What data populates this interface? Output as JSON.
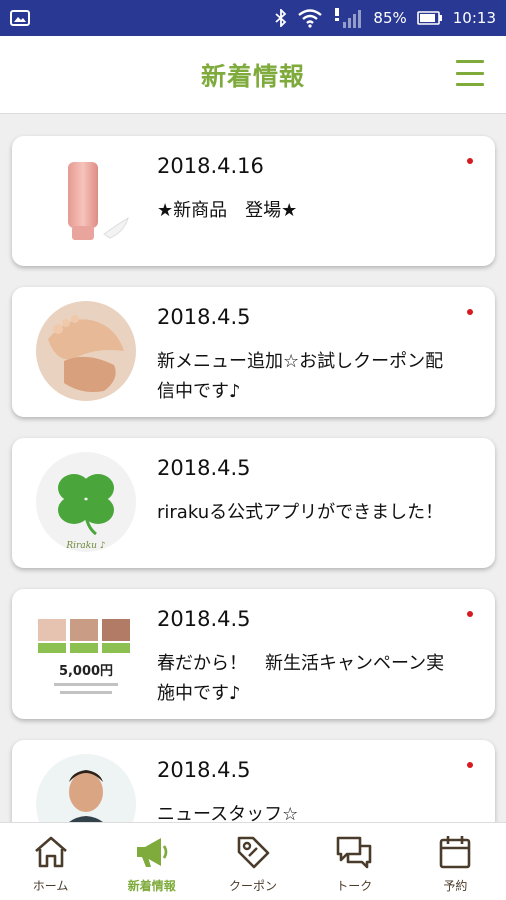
{
  "status_bar": {
    "battery": "85%",
    "time": "10:13"
  },
  "header": {
    "title": "新着情報"
  },
  "news": [
    {
      "date": "2018.4.16",
      "title": "★新商品　登場★",
      "unread": true
    },
    {
      "date": "2018.4.5",
      "title": "新メニュー追加☆お試しクーポン配信中です♪",
      "unread": true
    },
    {
      "date": "2018.4.5",
      "title": "rirakuる公式アプリができました！",
      "unread": false
    },
    {
      "date": "2018.4.5",
      "title": "春だから！　新生活キャンペーン実施中です♪",
      "unread": true
    },
    {
      "date": "2018.4.5",
      "title": "ニュースタッフ☆",
      "unread": true
    }
  ],
  "thumb_labels": {
    "logo_text": "Riraku ♪",
    "flyer_price": "5,000円"
  },
  "tabs": [
    {
      "label": "ホーム",
      "icon": "home-icon",
      "active": false
    },
    {
      "label": "新着情報",
      "icon": "megaphone-icon",
      "active": true
    },
    {
      "label": "クーポン",
      "icon": "tag-icon",
      "active": false
    },
    {
      "label": "トーク",
      "icon": "chat-icon",
      "active": false
    },
    {
      "label": "予約",
      "icon": "calendar-icon",
      "active": false
    }
  ],
  "colors": {
    "accent": "#7eab3c",
    "status_bar": "#283893",
    "unread_dot": "#d71920"
  }
}
